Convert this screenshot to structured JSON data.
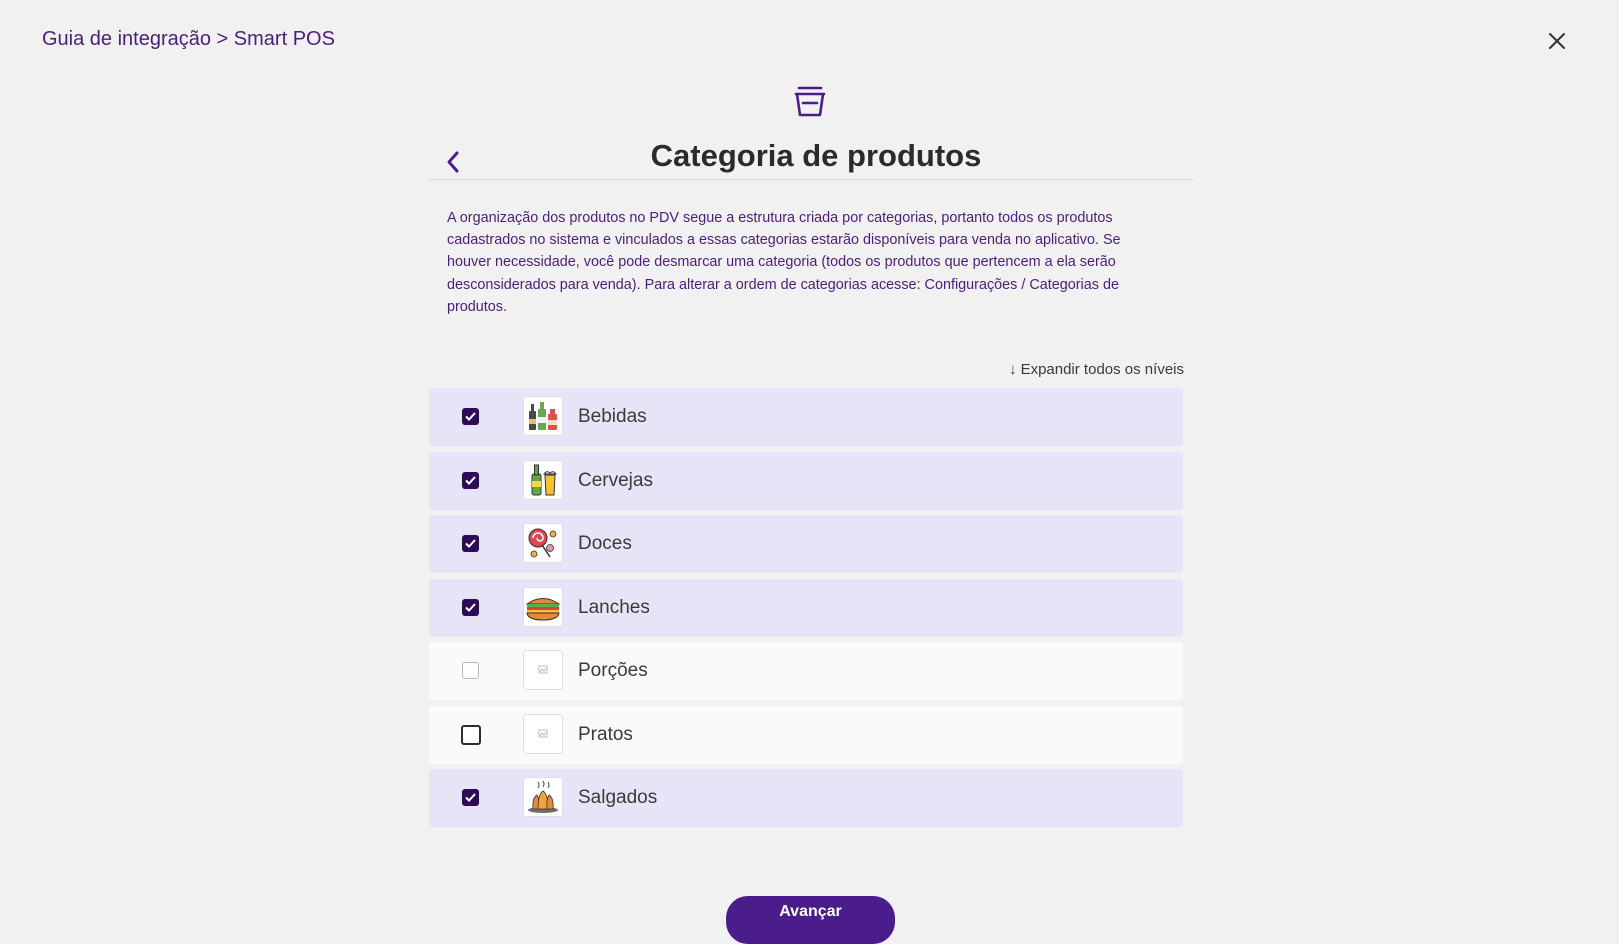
{
  "header": {
    "breadcrumb": "Guia de integração > Smart POS",
    "close_icon": "close-icon",
    "header_icon": "basket-icon"
  },
  "page": {
    "title": "Categoria de produtos",
    "back_icon": "chevron-left-icon",
    "description": "A organização dos produtos no PDV segue a estrutura criada por categorias, portanto todos os produtos cadastrados no sistema e vinculados a essas categorias estarão disponíveis para venda no aplicativo. Se houver necessidade, você pode desmarcar uma categoria (todos os produtos que pertencem a ela serão desconsiderados para venda). Para alterar a ordem de categorias acesse: Configurações / Categorias de produtos.",
    "expand_arrow": "↓",
    "expand_label": "Expandir todos os níveis"
  },
  "categories": [
    {
      "label": "Bebidas",
      "checked": true,
      "icon": "bottles-icon"
    },
    {
      "label": "Cervejas",
      "checked": true,
      "icon": "beer-icon"
    },
    {
      "label": "Doces",
      "checked": true,
      "icon": "candy-icon"
    },
    {
      "label": "Lanches",
      "checked": true,
      "icon": "sandwich-icon"
    },
    {
      "label": "Porções",
      "checked": false,
      "icon": "image-placeholder-icon"
    },
    {
      "label": "Pratos",
      "checked": false,
      "icon": "image-placeholder-icon"
    },
    {
      "label": "Salgados",
      "checked": true,
      "icon": "savory-snacks-icon"
    }
  ],
  "footer": {
    "next_label": "Avançar"
  },
  "colors": {
    "brand_purple": "#4b1c8c",
    "checkbox_fill": "#2d0b57",
    "row_checked_bg": "#e8e4f7",
    "row_unchecked_bg": "#fafafa"
  }
}
